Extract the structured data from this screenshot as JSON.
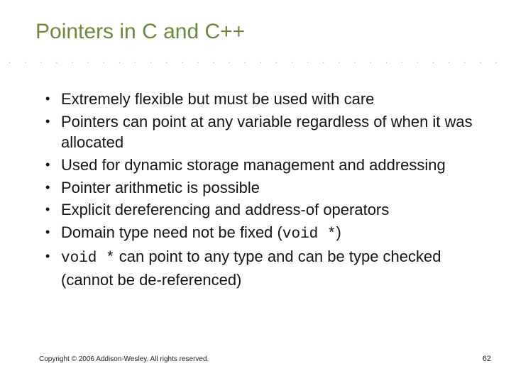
{
  "slide": {
    "title": "Pointers in C and C++",
    "bullets": [
      {
        "text": "Extremely flexible but must be used with care"
      },
      {
        "text": "Pointers can point at any variable regardless of when it was allocated"
      },
      {
        "text": "Used for dynamic storage management and addressing"
      },
      {
        "text": "Pointer arithmetic is possible"
      },
      {
        "text": "Explicit dereferencing and address-of operators"
      },
      {
        "prefix": "Domain type need not be fixed (",
        "code": "void *",
        "suffix": ")"
      },
      {
        "code_first": "void *",
        "rest": " can point to any type and can be type checked (cannot be de-referenced)"
      }
    ],
    "footer": "Copyright © 2006 Addison-Wesley. All rights reserved.",
    "page_number": "62"
  }
}
